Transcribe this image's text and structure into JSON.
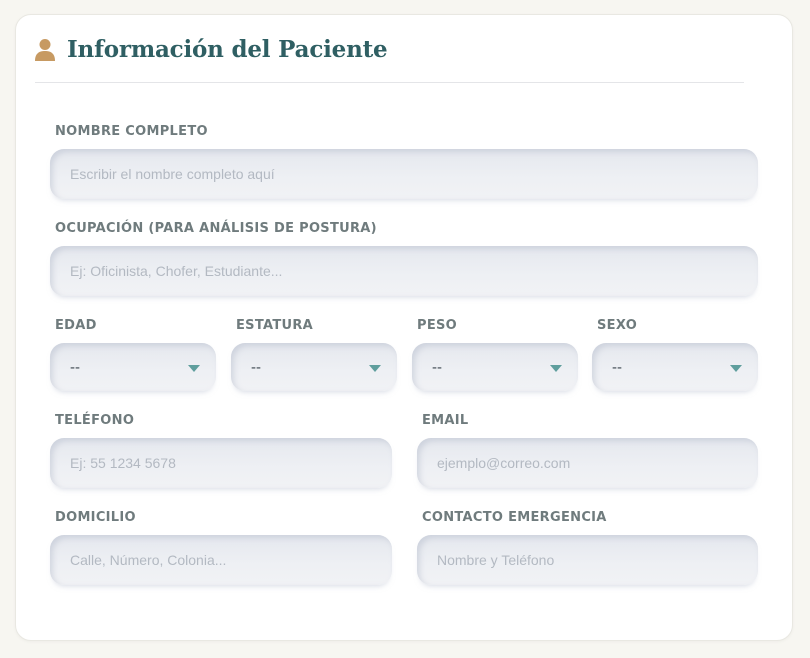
{
  "section": {
    "title": "Información del Paciente",
    "icon": "user-icon",
    "icon_color": "#c79a62",
    "title_color": "#2f5f63"
  },
  "fields": {
    "nombre": {
      "label": "NOMBRE COMPLETO",
      "placeholder": "Escribir el nombre completo aquí",
      "value": ""
    },
    "ocupacion": {
      "label": "OCUPACIÓN (PARA ANÁLISIS DE POSTURA)",
      "placeholder": "Ej: Oficinista, Chofer, Estudiante...",
      "value": ""
    },
    "edad": {
      "label": "EDAD",
      "selected": "--"
    },
    "estatura": {
      "label": "ESTATURA",
      "selected": "--"
    },
    "peso": {
      "label": "PESO",
      "selected": "--"
    },
    "sexo": {
      "label": "SEXO",
      "selected": "--"
    },
    "telefono": {
      "label": "TELÉFONO",
      "placeholder": "Ej: 55 1234 5678",
      "value": ""
    },
    "email": {
      "label": "EMAIL",
      "placeholder": "ejemplo@correo.com",
      "value": ""
    },
    "domicilio": {
      "label": "DOMICILIO",
      "placeholder": "Calle, Número, Colonia...",
      "value": ""
    },
    "emergencia": {
      "label": "CONTACTO EMERGENCIA",
      "placeholder": "Nombre y Teléfono",
      "value": ""
    }
  },
  "colors": {
    "accent": "#5f9e9d",
    "label": "#6f7b7d"
  }
}
